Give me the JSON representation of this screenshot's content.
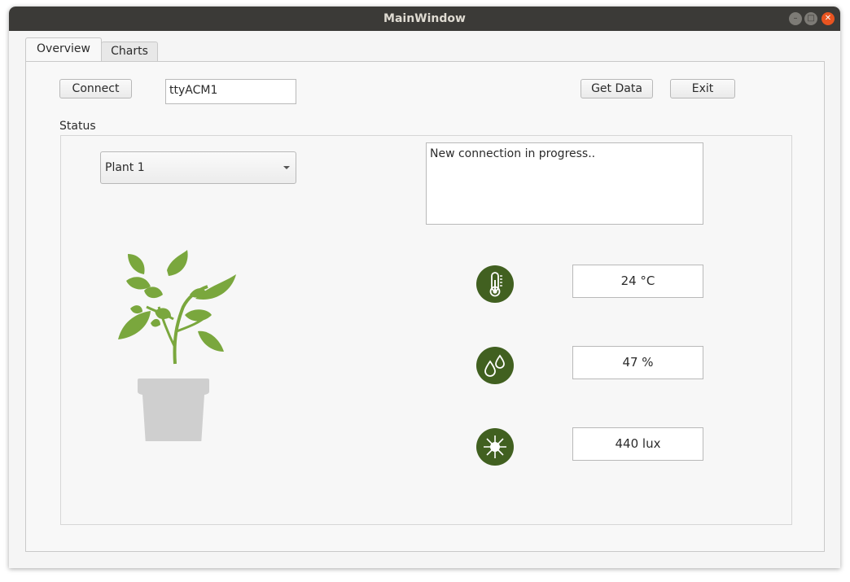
{
  "window": {
    "title": "MainWindow"
  },
  "tabs": [
    "Overview",
    "Charts"
  ],
  "toolbar": {
    "connect_label": "Connect",
    "port_value": "ttyACM1",
    "get_data_label": "Get Data",
    "exit_label": "Exit"
  },
  "status": {
    "label": "Status",
    "plant_select": "Plant 1",
    "log_text": "New connection in progress.."
  },
  "sensors": {
    "temperature": "24 °C",
    "humidity": "47 %",
    "light": "440 lux"
  },
  "icons": {
    "temperature": "thermometer-icon",
    "humidity": "water-drops-icon",
    "light": "sun-icon",
    "plant": "potted-plant-icon"
  },
  "colors": {
    "icon_bg": "#416020",
    "leaf": "#7aa73d",
    "pot": "#cfcfcf",
    "close_button": "#e95420"
  }
}
